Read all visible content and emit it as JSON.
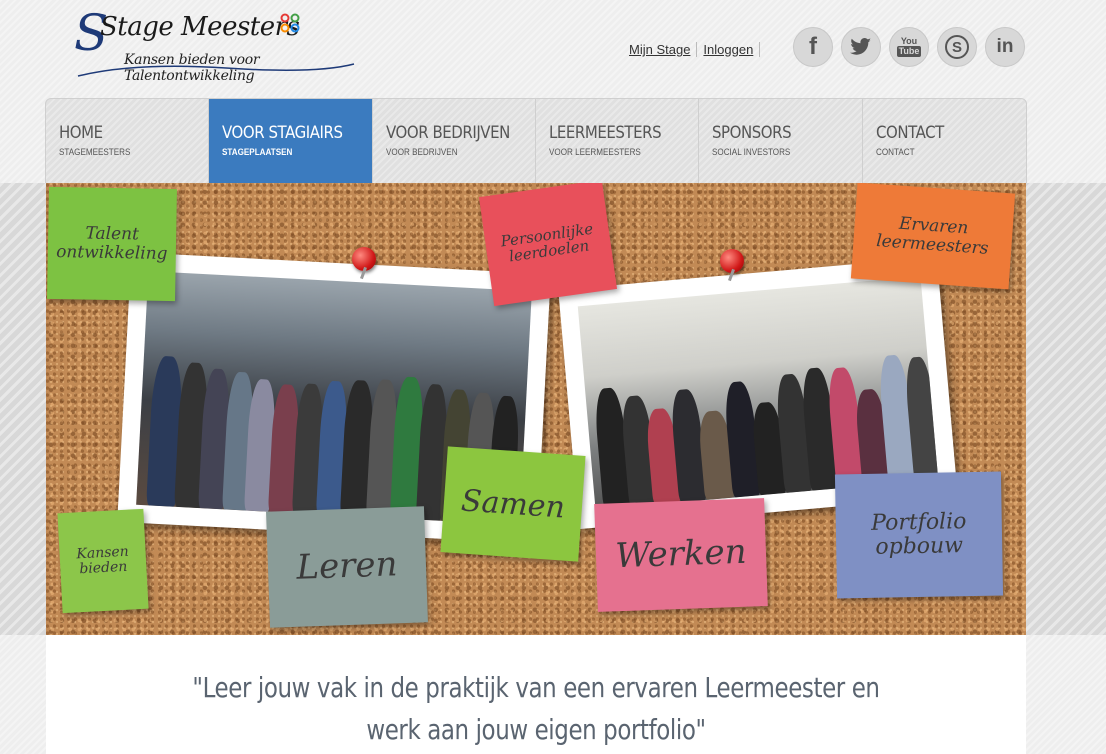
{
  "header": {
    "logo_title": "Stage Meesters",
    "logo_tagline": "Kansen bieden voor Talentontwikkeling",
    "links": [
      "Mijn Stage",
      "Inloggen"
    ],
    "social": [
      {
        "icon": "facebook-icon",
        "glyph": "f"
      },
      {
        "icon": "twitter-icon",
        "glyph": "🐦"
      },
      {
        "icon": "youtube-icon",
        "glyph": "You Tube"
      },
      {
        "icon": "skype-icon",
        "glyph": "S"
      },
      {
        "icon": "linkedin-icon",
        "glyph": "in"
      }
    ]
  },
  "nav": [
    {
      "title": "HOME",
      "sub": "STAGEMEESTERS",
      "active": false
    },
    {
      "title": "VOOR STAGIAIRS",
      "sub": "STAGEPLAATSEN",
      "active": true
    },
    {
      "title": "VOOR BEDRIJVEN",
      "sub": "VOOR BEDRIJVEN",
      "active": false
    },
    {
      "title": "LEERMEESTERS",
      "sub": "VOOR LEERMEESTERS",
      "active": false
    },
    {
      "title": "SPONSORS",
      "sub": "SOCIAL INVESTORS",
      "active": false
    },
    {
      "title": "CONTACT",
      "sub": "CONTACT",
      "active": false
    }
  ],
  "banner": {
    "notes": {
      "talent": "Talent ontwikkeling",
      "persoonlijke": "Persoonlijke leerdoelen",
      "ervaren": "Ervaren leermeesters",
      "kansen": "Kansen bieden",
      "leren": "Leren",
      "samen": "Samen",
      "werken": "Werken",
      "portfolio": "Portfolio opbouw"
    }
  },
  "content": {
    "quote_line1": "\"Leer jouw vak in de praktijk van een ervaren Leermeester en",
    "quote_line2": "werk aan jouw eigen portfolio\""
  },
  "colors": {
    "nav_active": "#3b7bbf",
    "note_green": "#7dc242",
    "note_red": "#e8505b",
    "note_orange": "#ee7a38",
    "note_grey": "#8a9c98",
    "note_pink": "#e5718f",
    "note_blue": "#7f90c4"
  }
}
